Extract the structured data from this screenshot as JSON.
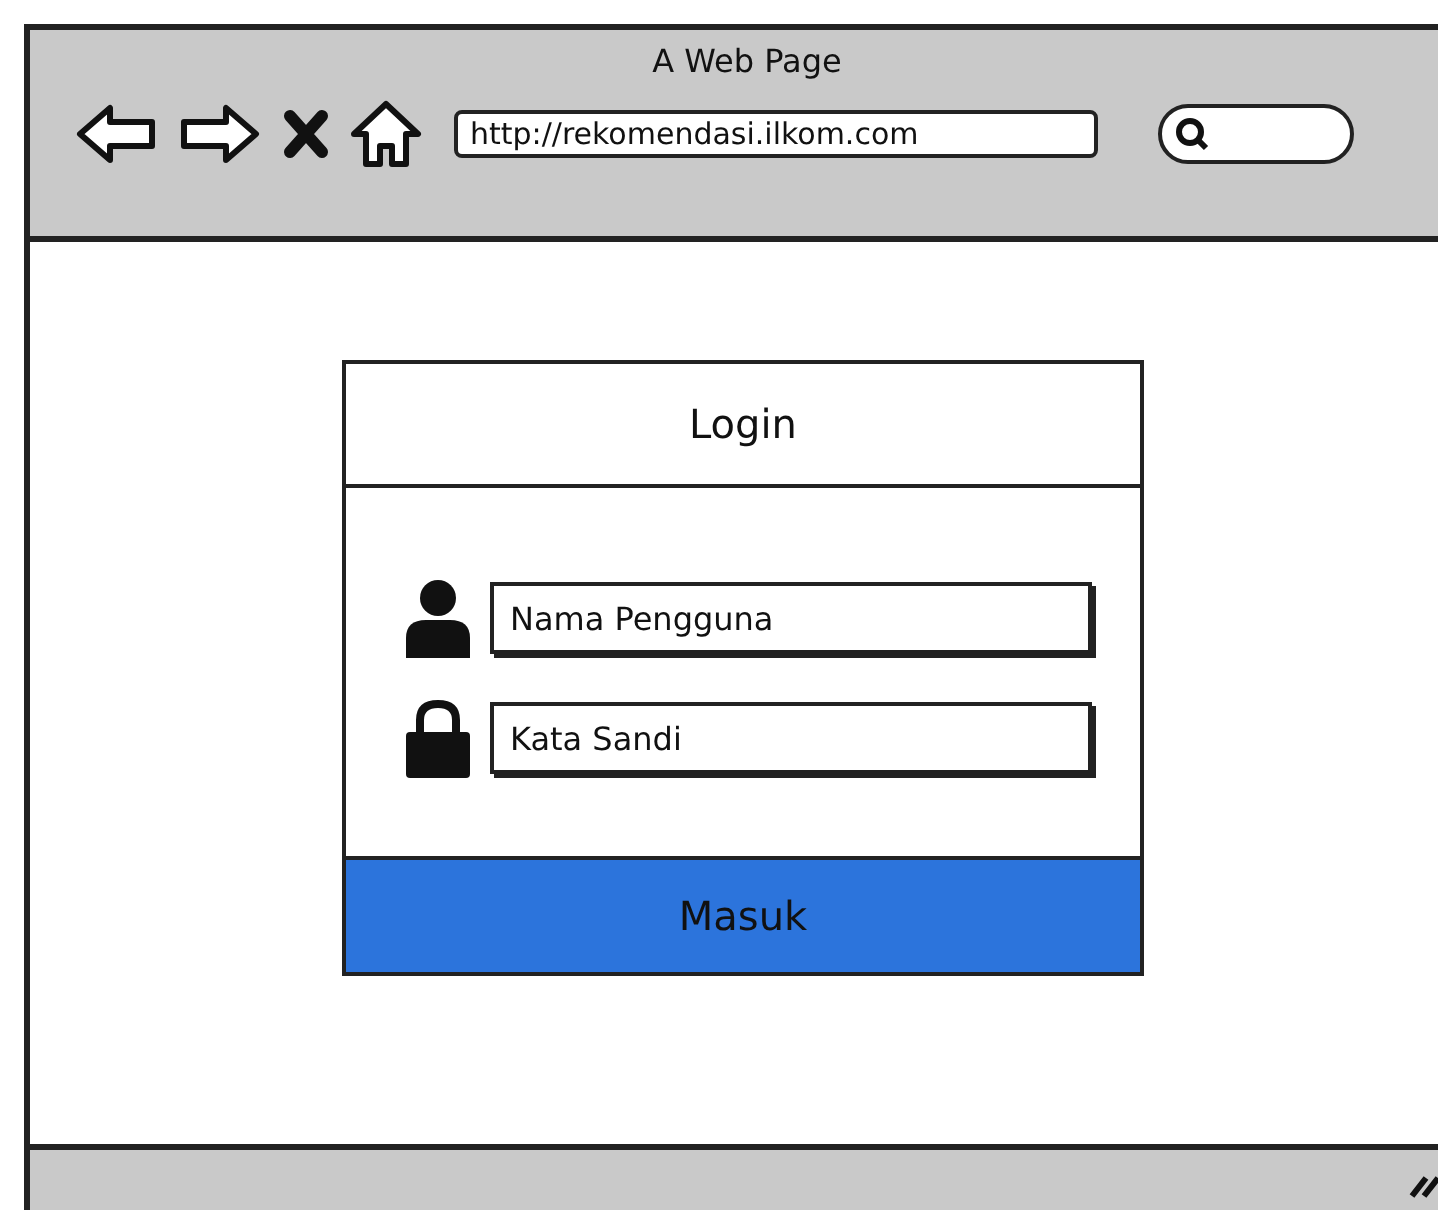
{
  "window": {
    "title": "A Web Page"
  },
  "address_bar": {
    "value": "http://rekomendasi.ilkom.com"
  },
  "login": {
    "title": "Login",
    "fields": [
      {
        "kind": "user",
        "placeholder": "Nama Pengguna"
      },
      {
        "kind": "password",
        "placeholder": "Kata Sandi"
      }
    ],
    "button": "Masuk"
  }
}
